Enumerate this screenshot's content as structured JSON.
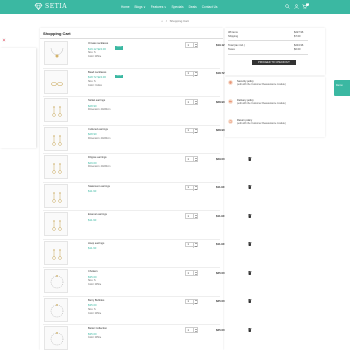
{
  "header": {
    "brand": "SETIA",
    "nav": [
      "Home",
      "Blogs ∨",
      "Features ∨",
      "Specials",
      "Deals",
      "Contact Us"
    ],
    "cart_count": "1",
    "colors": {
      "accent": "#3bb8a2"
    }
  },
  "breadcrumb": {
    "home_icon": "home-icon",
    "separator": "/",
    "current": "Shopping Cart"
  },
  "cart": {
    "title": "Shopping Cart",
    "items": [
      {
        "name": "Ornate necklaces",
        "price": "$19.12 $24.00",
        "discount": "-20%",
        "attr": "Size: S",
        "attr2": "Color: White",
        "qty": "1",
        "total": "$19.12",
        "icon": "necklace-image"
      },
      {
        "name": "Bead necklaces",
        "price": "$18.72 $24.00",
        "discount": "-22%",
        "attr": "Size: S",
        "attr2": "Color: Yellow",
        "qty": "1",
        "total": "$18.72",
        "icon": "ring-image"
      },
      {
        "name": "Nickel earrings",
        "price": "$28.90",
        "discount": "",
        "attr": "Dimension: 40x60cm",
        "attr2": "",
        "qty": "1",
        "total": "$28.90",
        "icon": "earring-image"
      },
      {
        "name": "Cultured earrings",
        "price": "$28.90",
        "discount": "",
        "attr": "Dimension: 40x60cm",
        "attr2": "",
        "qty": "1",
        "total": "$28.90",
        "icon": "earring-image"
      },
      {
        "name": "Filigree earrings",
        "price": "$29.00",
        "discount": "",
        "attr": "Dimension: 40x60cm",
        "attr2": "",
        "qty": "1",
        "total": "$29.00",
        "icon": "earring-image"
      },
      {
        "name": "Statement earrings",
        "price": "$11.90",
        "discount": "",
        "attr": "",
        "attr2": "",
        "qty": "1",
        "total": "$11.90",
        "icon": "earring-image"
      },
      {
        "name": "Enamel earrings",
        "price": "$11.90",
        "discount": "",
        "attr": "",
        "attr2": "",
        "qty": "1",
        "total": "$11.90",
        "icon": "earring-image"
      },
      {
        "name": "Hoop earrings",
        "price": "$11.90",
        "discount": "",
        "attr": "",
        "attr2": "",
        "qty": "1",
        "total": "$11.90",
        "icon": "earring-image"
      },
      {
        "name": "Chokers",
        "price": "$35.00",
        "discount": "",
        "attr": "Size: S",
        "attr2": "Color: White",
        "qty": "1",
        "total": "$35.00",
        "icon": "bracelet-image"
      },
      {
        "name": "Berry Bubbles",
        "price": "$35.00",
        "discount": "",
        "attr": "Size: S",
        "attr2": "Color: White",
        "qty": "1",
        "total": "$35.00",
        "icon": "bracelet-image"
      },
      {
        "name": "Better Collection",
        "price": "$35.00",
        "discount": "",
        "attr": "Color: White",
        "attr2": "",
        "qty": "1",
        "total": "$35.00",
        "icon": "bracelet-image"
      }
    ]
  },
  "summary": {
    "items_label": "38 items",
    "items_value": "$227.96",
    "shipping_label": "Shipping",
    "shipping_value": "$7.00",
    "total_label": "Total (tax incl.)",
    "total_value": "$234.96",
    "taxes_label": "Taxes",
    "taxes_value": "$0.00",
    "checkout_label": "PROCEED TO CHECKOUT"
  },
  "reassurance": [
    {
      "title": "Security policy",
      "desc": "(edit with the Customer Reassurance module)",
      "icon": "shield-icon"
    },
    {
      "title": "Delivery policy",
      "desc": "(edit with the Customer Reassurance module)",
      "icon": "truck-icon"
    },
    {
      "title": "Return policy",
      "desc": "(edit with the Customer Reassurance module)",
      "icon": "return-icon"
    }
  ],
  "side_tab": {
    "label": "Demo"
  }
}
